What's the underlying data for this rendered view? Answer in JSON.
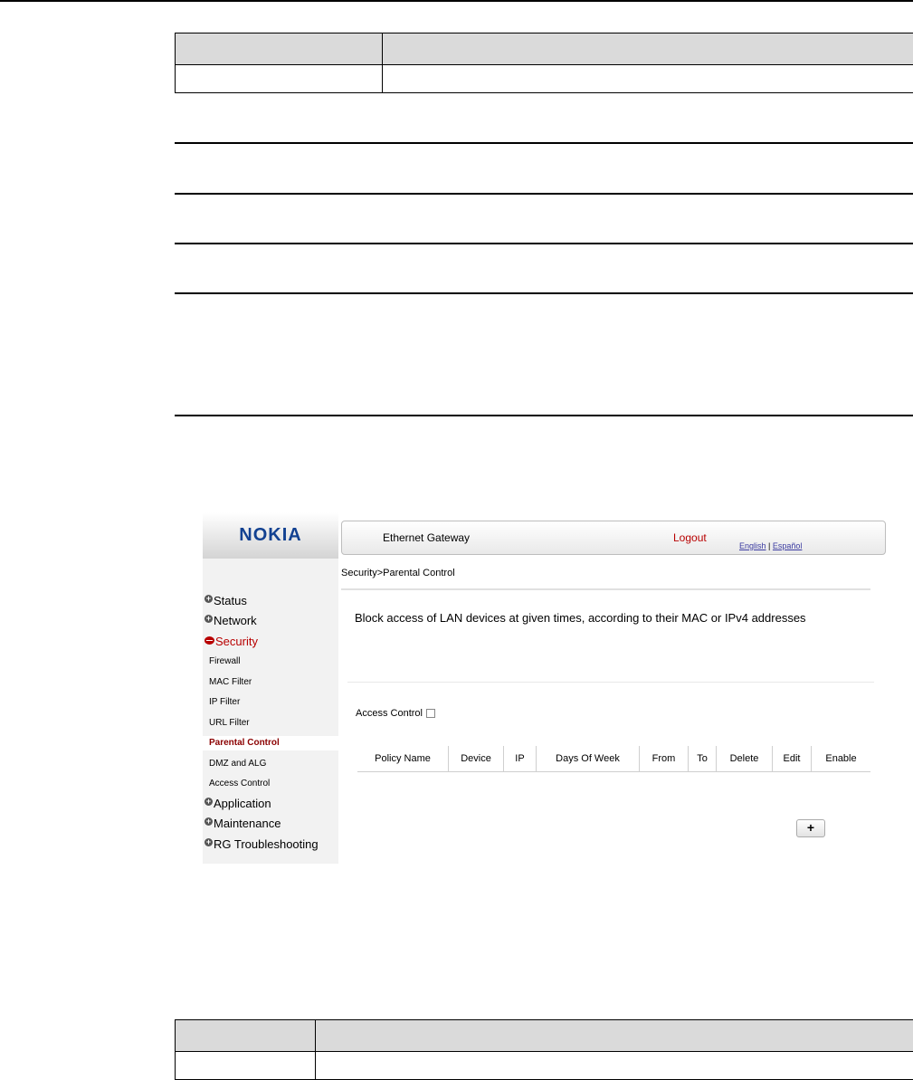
{
  "app": {
    "logo": "NOKIA",
    "title": "Ethernet Gateway",
    "logout": "Logout",
    "lang_english": "English",
    "lang_separator": "|",
    "lang_espanol": "Español"
  },
  "sidebar": {
    "main_items": [
      {
        "label": "Status",
        "icon": "plus-icon"
      },
      {
        "label": "Network",
        "icon": "plus-icon"
      },
      {
        "label": "Security",
        "icon": "minus-icon",
        "active": true
      }
    ],
    "security_subitems": [
      {
        "label": "Firewall"
      },
      {
        "label": "MAC Filter"
      },
      {
        "label": "IP Filter"
      },
      {
        "label": "URL Filter"
      },
      {
        "label": "Parental Control",
        "active": true
      },
      {
        "label": "DMZ and ALG"
      },
      {
        "label": "Access Control"
      }
    ],
    "bottom_items": [
      {
        "label": "Application",
        "icon": "plus-icon"
      },
      {
        "label": "Maintenance",
        "icon": "plus-icon"
      },
      {
        "label": "RG Troubleshooting",
        "icon": "plus-icon"
      }
    ]
  },
  "content": {
    "breadcrumb": "Security>Parental Control",
    "description": "Block access of LAN devices at given times, according to their MAC or IPv4 addresses",
    "access_control_label": "Access Control",
    "table_headers": [
      "Policy Name",
      "Device",
      "IP",
      "Days Of Week",
      "From",
      "To",
      "Delete",
      "Edit",
      "Enable"
    ],
    "add_button": "+"
  },
  "colors": {
    "accent_red": "#b80000",
    "nokia_blue": "#124191",
    "sidebar_bg": "#f2f2f2"
  }
}
